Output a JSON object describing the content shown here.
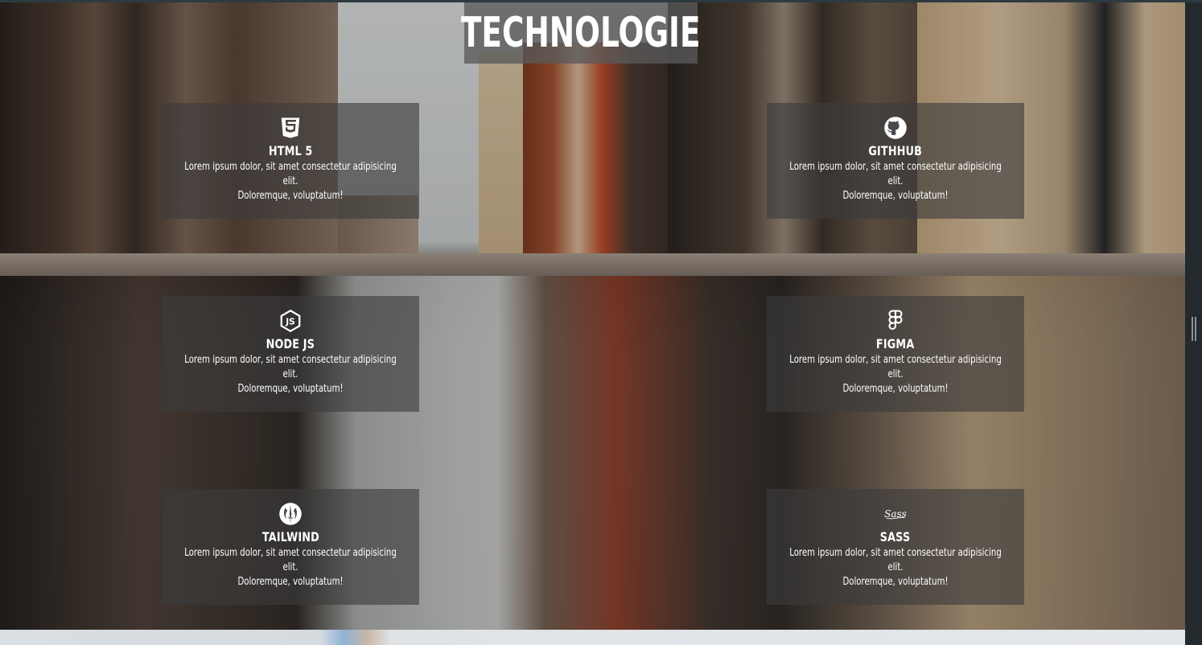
{
  "section": {
    "title": "TECHNOLOGIE"
  },
  "cards": [
    {
      "name": "HTML 5",
      "icon": "html5-icon",
      "line1": "Lorem ipsum dolor, sit amet consectetur adipisicing elit.",
      "line2": "Doloremque, voluptatum!"
    },
    {
      "name": "GITHHUB",
      "icon": "github-icon",
      "line1": "Lorem ipsum dolor, sit amet consectetur adipisicing elit.",
      "line2": "Doloremque, voluptatum!"
    },
    {
      "name": "NODE JS",
      "icon": "nodejs-icon",
      "line1": "Lorem ipsum dolor, sit amet consectetur adipisicing elit.",
      "line2": "Doloremque, voluptatum!"
    },
    {
      "name": "FIGMA",
      "icon": "figma-icon",
      "line1": "Lorem ipsum dolor, sit amet consectetur adipisicing elit.",
      "line2": "Doloremque, voluptatum!"
    },
    {
      "name": "TAILWIND",
      "icon": "jedi-order-icon",
      "line1": "Lorem ipsum dolor, sit amet consectetur adipisicing elit.",
      "line2": "Doloremque, voluptatum!"
    },
    {
      "name": "SASS",
      "icon": "sass-icon",
      "line1": "Lorem ipsum dolor, sit amet consectetur adipisicing elit.",
      "line2": "Doloremque, voluptatum!"
    }
  ],
  "colors": {
    "card_bg": "#3c3c3c",
    "title_bg": "#5a5a5a",
    "text": "#ffffff"
  }
}
